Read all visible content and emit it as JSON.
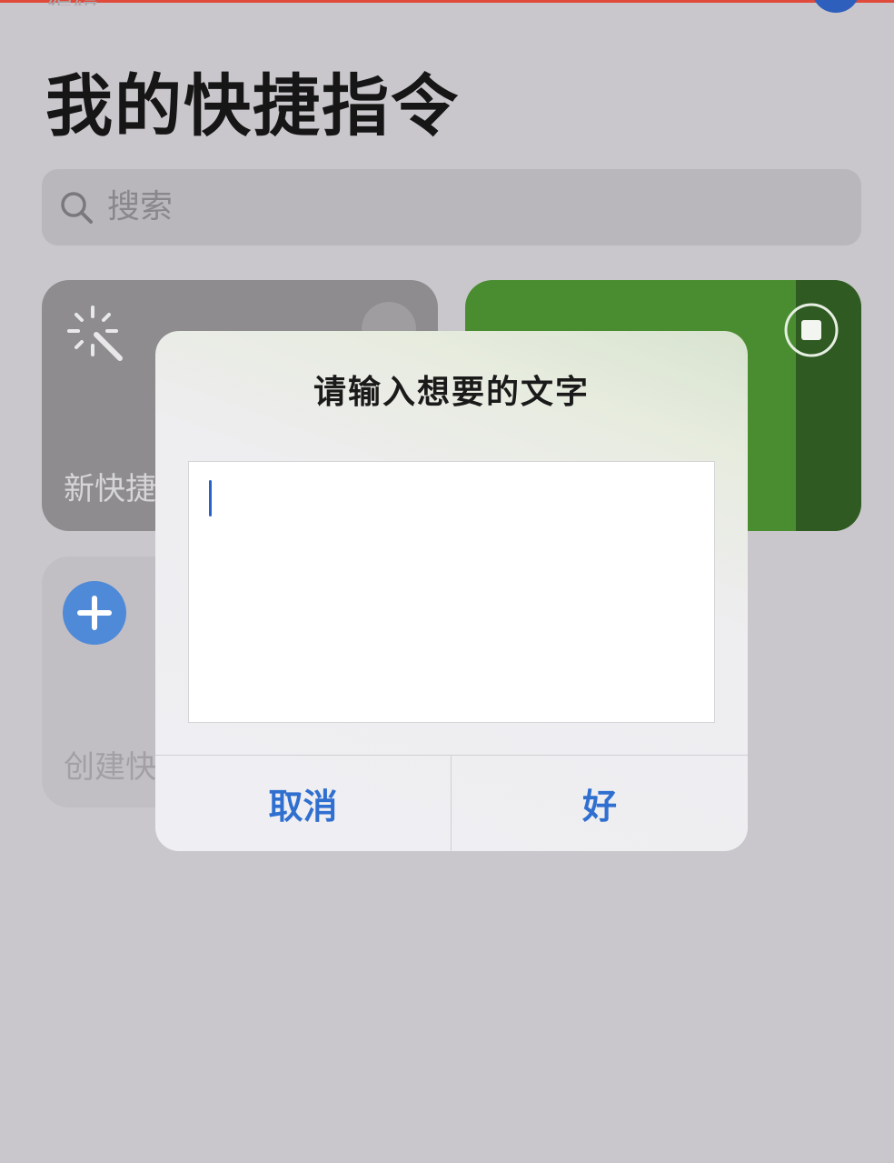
{
  "page": {
    "title": "我的快捷指令",
    "top_ghost_text": "编辑"
  },
  "search": {
    "placeholder": "搜索"
  },
  "cards": {
    "new_shortcut_label": "新快捷指令",
    "create_shortcut_label": "创建快捷指令",
    "new_card_icon": "magic-wand-icon",
    "new_card_more_icon": "more-icon",
    "green_card_icon": "stop-icon",
    "create_card_icon": "plus-icon"
  },
  "dialog": {
    "title": "请输入想要的文字",
    "input_value": "",
    "cancel_label": "取消",
    "ok_label": "好"
  },
  "colors": {
    "accent": "#2f6fd0",
    "green_card": "#4a8d31",
    "green_card_dark": "#2f5a22",
    "plus_button": "#4f8ad8"
  }
}
